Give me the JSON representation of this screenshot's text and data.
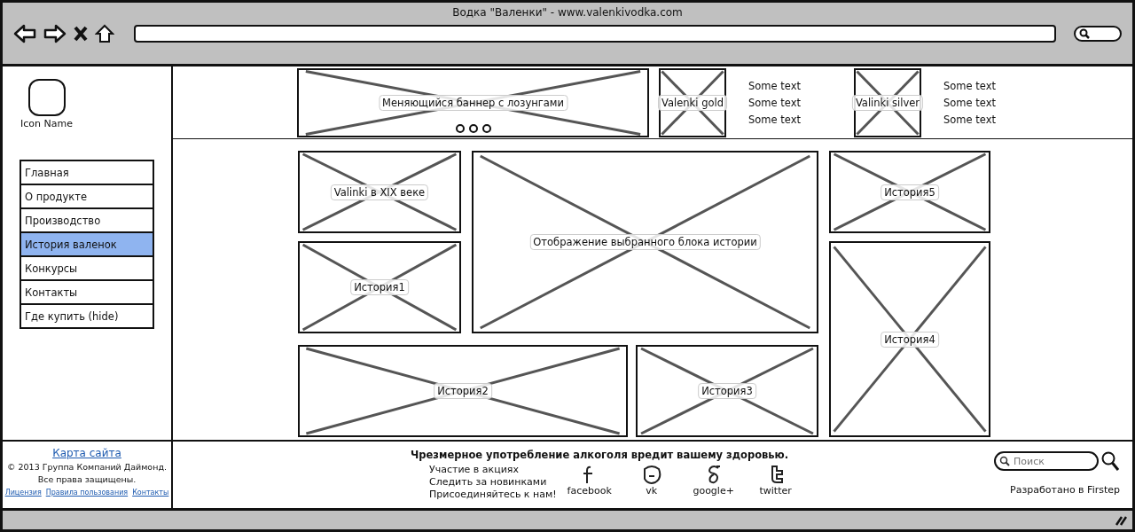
{
  "browser": {
    "title": "Водка \"Валенки\" - www.valenkivodka.com"
  },
  "sidebar": {
    "icon_label": "Icon Name",
    "nav": [
      {
        "label": "Главная",
        "selected": false
      },
      {
        "label": "О продукте",
        "selected": false
      },
      {
        "label": "Производство",
        "selected": false
      },
      {
        "label": "История валенок",
        "selected": true
      },
      {
        "label": "Конкурсы",
        "selected": false
      },
      {
        "label": "Контакты",
        "selected": false
      },
      {
        "label": "Где купить (hide)",
        "selected": false
      }
    ]
  },
  "header": {
    "banner": {
      "label": "Меняющийся баннер с лозунгами"
    },
    "products": [
      {
        "label": "Valenki gold",
        "lines": [
          "Some text",
          "Some text",
          "Some text"
        ]
      },
      {
        "label": "Valinki silver",
        "lines": [
          "Some text",
          "Some text",
          "Some text"
        ]
      }
    ]
  },
  "blocks": [
    {
      "label": "Valinki в XIX веке"
    },
    {
      "label": "Отображение выбранного блока истории"
    },
    {
      "label": "История5"
    },
    {
      "label": "История1"
    },
    {
      "label": "История4"
    },
    {
      "label": "История2"
    },
    {
      "label": "История3"
    }
  ],
  "footer": {
    "sitemap_link": "Карта сайта",
    "copyright": [
      "© 2013 Группа Компаний Даймонд.",
      "Все права защищены."
    ],
    "links": [
      "Лицензия",
      "Правила пользования",
      "Контакты"
    ],
    "warning": "Чрезмерное употребление алкоголя вредит вашему здоровью.",
    "subscribe": [
      "Участие в акциях",
      "Следить за новинками",
      "Присоединяйтесь к нам!"
    ],
    "social": [
      {
        "kind": "facebook",
        "label": "facebook"
      },
      {
        "kind": "vk",
        "label": "vk"
      },
      {
        "kind": "google",
        "label": "google+"
      },
      {
        "kind": "twitter",
        "label": "twitter"
      }
    ],
    "search": {
      "placeholder": "Поиск"
    },
    "credit": "Разработано в Firstep"
  }
}
